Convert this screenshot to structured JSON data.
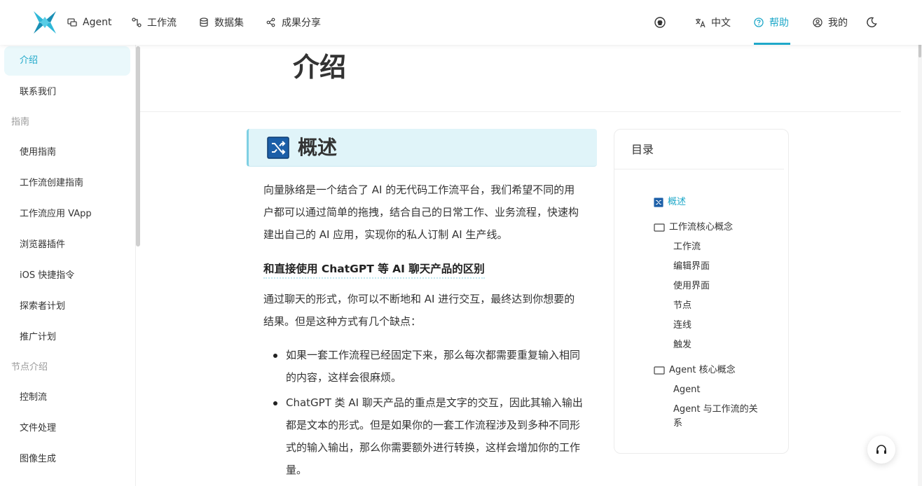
{
  "nav": {
    "items": [
      {
        "label": "Agent",
        "icon": "chat-icon"
      },
      {
        "label": "工作流",
        "icon": "workflow-icon"
      },
      {
        "label": "数据集",
        "icon": "database-icon"
      },
      {
        "label": "成果分享",
        "icon": "share-icon"
      }
    ],
    "right": {
      "github_icon": "github-icon",
      "language_label": "中文",
      "help_label": "帮助",
      "profile_label": "我的",
      "theme_icon": "moon-icon"
    },
    "accent_color": "#1fa8c9"
  },
  "sidebar": {
    "items": [
      {
        "type": "item",
        "label": "介绍",
        "active": true
      },
      {
        "type": "item",
        "label": "联系我们"
      },
      {
        "type": "group",
        "label": "指南"
      },
      {
        "type": "item",
        "label": "使用指南"
      },
      {
        "type": "item",
        "label": "工作流创建指南"
      },
      {
        "type": "item",
        "label": "工作流应用 VApp"
      },
      {
        "type": "item",
        "label": "浏览器插件"
      },
      {
        "type": "item",
        "label": "iOS 快捷指令"
      },
      {
        "type": "item",
        "label": "探索者计划"
      },
      {
        "type": "item",
        "label": "推广计划"
      },
      {
        "type": "group",
        "label": "节点介绍"
      },
      {
        "type": "item",
        "label": "控制流"
      },
      {
        "type": "item",
        "label": "文件处理"
      },
      {
        "type": "item",
        "label": "图像生成"
      }
    ]
  },
  "main": {
    "page_title": "介绍",
    "section_title": "概述",
    "intro": "向量脉络是一个结合了 AI 的无代码工作流平台，我们希望不同的用户都可以通过简单的拖拽，结合自己的日常工作、业务流程，快速构建出自己的 AI 应用，实现你的私人订制 AI 生产线。",
    "subhead": "和直接使用 ChatGPT 等 AI 聊天产品的区别",
    "para2": "通过聊天的形式，你可以不断地和 AI 进行交互，最终达到你想要的结果。但是这种方式有几个缺点：",
    "bullets": [
      "如果一套工作流程已经固定下来，那么每次都需要重复输入相同的内容，这样会很麻烦。",
      "ChatGPT 类 AI 聊天产品的重点是文字的交互，因此其输入输出都是文本的形式。但是如果你的一套工作流程涉及到多种不同形式的输入输出，那么你需要额外进行转换，这样会增加你的工作量。"
    ]
  },
  "toc": {
    "title": "目录",
    "items": [
      {
        "label": "概述",
        "level": 1,
        "icon": "shuffle-icon",
        "active": true
      },
      {
        "label": "工作流核心概念",
        "level": 1,
        "icon": "book-icon"
      },
      {
        "label": "工作流",
        "level": 2
      },
      {
        "label": "编辑界面",
        "level": 2
      },
      {
        "label": "使用界面",
        "level": 2
      },
      {
        "label": "节点",
        "level": 2
      },
      {
        "label": "连线",
        "level": 2
      },
      {
        "label": "触发",
        "level": 2
      },
      {
        "label": "Agent 核心概念",
        "level": 1,
        "icon": "book-icon"
      },
      {
        "label": "Agent",
        "level": 2
      },
      {
        "label": "Agent 与工作流的关系",
        "level": 2
      }
    ]
  },
  "support_icon": "headset-icon"
}
